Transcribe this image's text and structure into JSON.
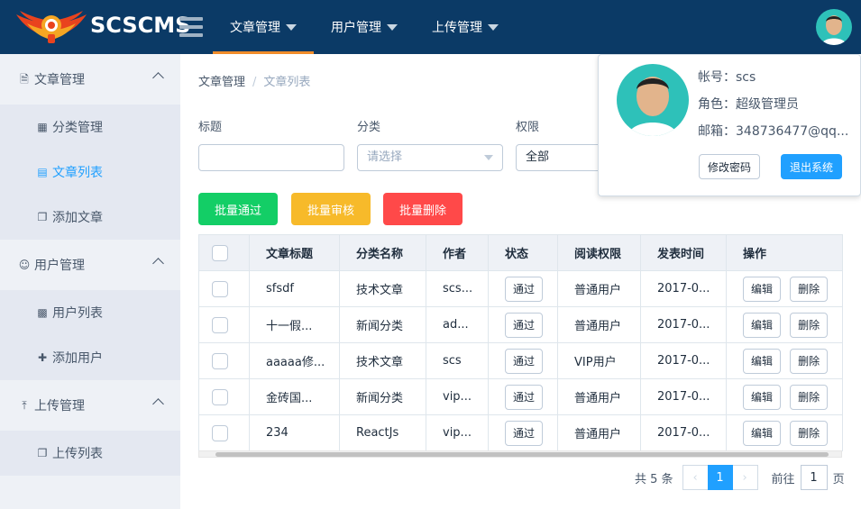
{
  "header": {
    "brand": "SCSCMS",
    "nav": [
      {
        "label": "文章管理"
      },
      {
        "label": "用户管理"
      },
      {
        "label": "上传管理"
      }
    ]
  },
  "sidebar": {
    "groups": [
      {
        "label": "文章管理",
        "items": [
          {
            "label": "分类管理"
          },
          {
            "label": "文章列表"
          },
          {
            "label": "添加文章"
          }
        ]
      },
      {
        "label": "用户管理",
        "items": [
          {
            "label": "用户列表"
          },
          {
            "label": "添加用户"
          }
        ]
      },
      {
        "label": "上传管理",
        "items": [
          {
            "label": "上传列表"
          }
        ]
      }
    ]
  },
  "breadcrumb": {
    "root": "文章管理",
    "sep": "/",
    "current": "文章列表"
  },
  "filters": {
    "title_label": "标题",
    "title_value": "",
    "category_label": "分类",
    "category_placeholder": "请选择",
    "permission_label": "权限",
    "permission_value": "全部"
  },
  "actions": {
    "approve": "批量通过",
    "review": "批量审核",
    "delete": "批量删除"
  },
  "table": {
    "headers": [
      "文章标题",
      "分类名称",
      "作者",
      "状态",
      "阅读权限",
      "发表时间",
      "操作"
    ],
    "rows": [
      {
        "title": "sfsdf",
        "category": "技术文章",
        "author": "scs...",
        "status": "通过",
        "permission": "普通用户",
        "time": "2017-0...",
        "edit": "编辑",
        "delete": "删除"
      },
      {
        "title": "十一假...",
        "category": "新闻分类",
        "author": "ad...",
        "status": "通过",
        "permission": "普通用户",
        "time": "2017-0...",
        "edit": "编辑",
        "delete": "删除"
      },
      {
        "title": "aaaaa修...",
        "category": "技术文章",
        "author": "scs",
        "status": "通过",
        "permission": "VIP用户",
        "time": "2017-0...",
        "edit": "编辑",
        "delete": "删除"
      },
      {
        "title": "金砖国...",
        "category": "新闻分类",
        "author": "vip...",
        "status": "通过",
        "permission": "普通用户",
        "time": "2017-0...",
        "edit": "编辑",
        "delete": "删除"
      },
      {
        "title": "234",
        "category": "ReactJs",
        "author": "vip...",
        "status": "通过",
        "permission": "普通用户",
        "time": "2017-0...",
        "edit": "编辑",
        "delete": "删除"
      }
    ]
  },
  "pagination": {
    "total": "共 5 条",
    "current_page": "1",
    "goto_prefix": "前往",
    "goto_value": "1",
    "goto_suffix": "页"
  },
  "popover": {
    "account": "帐号：scs",
    "role": "角色：超级管理员",
    "email": "邮箱：348736477@qq...",
    "change_password": "修改密码",
    "logout": "退出系统"
  },
  "colors": {
    "header_bg": "#0b3a66",
    "nav_active_bar": "#f08c2a",
    "approve": "#13ce66",
    "review": "#f7ba2a",
    "delete": "#ff4949",
    "primary": "#20a0ff"
  }
}
